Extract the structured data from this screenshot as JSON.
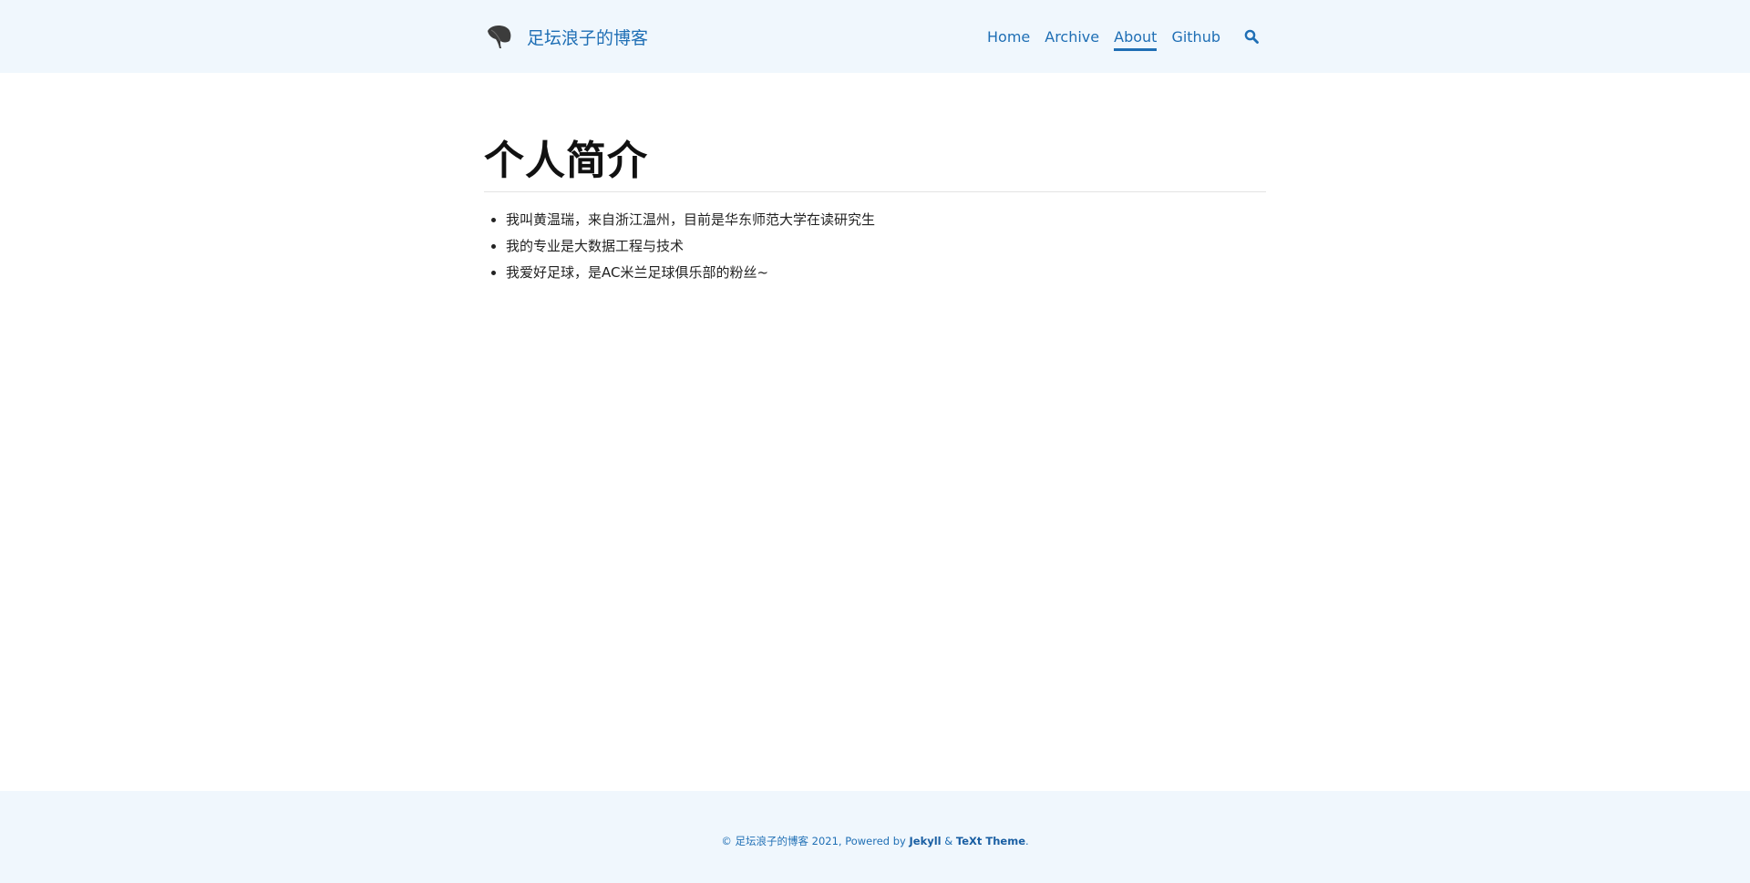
{
  "header": {
    "site_title": "足坛浪子的博客",
    "logo_icon": "ginkgo-leaf-icon",
    "nav": [
      {
        "label": "Home",
        "active": false
      },
      {
        "label": "Archive",
        "active": false
      },
      {
        "label": "About",
        "active": true
      },
      {
        "label": "Github",
        "active": false
      }
    ],
    "search_icon": "search-icon"
  },
  "main": {
    "title": "个人简介",
    "items": [
      "我叫黄温瑞，来自浙江温州，目前是华东师范大学在读研究生",
      "我的专业是大数据工程与技术",
      "我爱好足球，是AC米兰足球俱乐部的粉丝~"
    ]
  },
  "footer": {
    "prefix": "© 足坛浪子的博客 2021, Powered by ",
    "jekyll": "Jekyll",
    "amp": " & ",
    "theme": "TeXt Theme",
    "suffix": "."
  },
  "colors": {
    "accent": "#1f6fb5",
    "header_bg": "#f0f7fd",
    "footer_bg": "#f0f7fd"
  }
}
